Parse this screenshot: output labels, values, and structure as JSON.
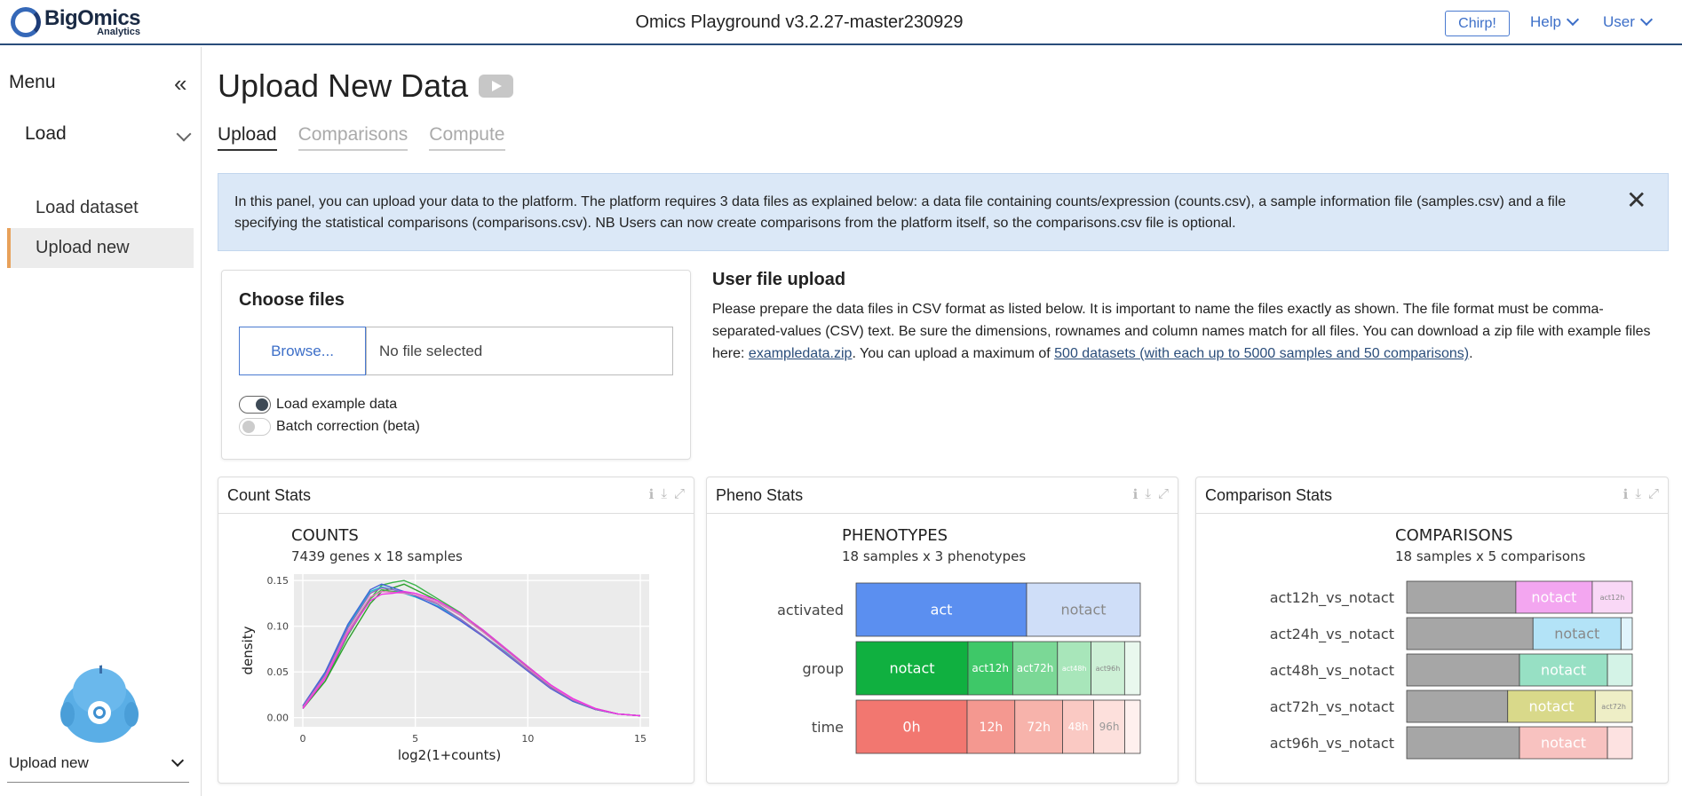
{
  "header": {
    "logo_main": "BigOmics",
    "logo_sub": "Analytics",
    "app_title": "Omics Playground v3.2.27-master230929",
    "chirp": "Chirp!",
    "help": "Help",
    "user": "User"
  },
  "sidebar": {
    "title": "Menu",
    "collapse_glyph": "«",
    "section": "Load",
    "items": [
      {
        "label": "Load dataset",
        "active": false
      },
      {
        "label": "Upload new",
        "active": true
      }
    ],
    "bottom_label": "Upload new"
  },
  "main": {
    "title": "Upload New Data",
    "tabs": [
      {
        "label": "Upload",
        "active": true
      },
      {
        "label": "Comparisons",
        "active": false
      },
      {
        "label": "Compute",
        "active": false
      }
    ],
    "info_text": "In this panel, you can upload your data to the platform. The platform requires 3 data files as explained below: a data file containing counts/expression (counts.csv), a sample information file (samples.csv) and a file specifying the statistical comparisons (comparisons.csv). NB Users can now create comparisons from the platform itself, so the comparisons.csv file is optional.",
    "info_close": "✕"
  },
  "choose_files": {
    "title": "Choose files",
    "browse_label": "Browse...",
    "file_status": "No file selected",
    "toggles": [
      {
        "label": "Load example data",
        "on": true
      },
      {
        "label": "Batch correction (beta)",
        "on": false
      }
    ]
  },
  "user_upload": {
    "title": "User file upload",
    "text_pre": "Please prepare the data files in CSV format as listed below. It is important to name the files exactly as shown. The file format must be comma-separated-values (CSV) text. Be sure the dimensions, rownames and column names match for all files. You can download a zip file with example files here: ",
    "link1": "exampledata.zip",
    "text_mid": ". You can upload a maximum of ",
    "link2": "500 datasets (with each up to 5000 samples and 50 comparisons)",
    "text_post": "."
  },
  "panels": {
    "count_stats": "Count Stats",
    "pheno_stats": "Pheno Stats",
    "comparison_stats": "Comparison Stats"
  },
  "chart_data": [
    {
      "type": "line",
      "title": "COUNTS",
      "subtitle": "7439 genes x 18 samples",
      "xlabel": "log2(1+counts)",
      "ylabel": "density",
      "xlim": [
        0,
        15
      ],
      "ylim": [
        0,
        0.15
      ],
      "xticks": [
        "0",
        "5",
        "10",
        "15"
      ],
      "yticks": [
        "0.00",
        "0.05",
        "0.10",
        "0.15"
      ],
      "x": [
        0,
        1,
        2,
        3,
        3.5,
        4,
        4.5,
        5,
        6,
        7,
        8,
        9,
        10,
        11,
        12,
        13,
        14,
        15
      ],
      "series": [
        {
          "color": "#3cb44b",
          "values": [
            0.01,
            0.04,
            0.09,
            0.13,
            0.145,
            0.148,
            0.15,
            0.145,
            0.13,
            0.115,
            0.095,
            0.075,
            0.055,
            0.035,
            0.02,
            0.01,
            0.004,
            0.002
          ]
        },
        {
          "color": "#2ca02c",
          "values": [
            0.01,
            0.04,
            0.085,
            0.125,
            0.138,
            0.142,
            0.146,
            0.14,
            0.128,
            0.114,
            0.096,
            0.076,
            0.056,
            0.036,
            0.02,
            0.01,
            0.004,
            0.002
          ]
        },
        {
          "color": "#4daf4a",
          "values": [
            0.012,
            0.045,
            0.092,
            0.13,
            0.14,
            0.138,
            0.137,
            0.134,
            0.126,
            0.112,
            0.094,
            0.075,
            0.054,
            0.034,
            0.019,
            0.009,
            0.004,
            0.002
          ]
        },
        {
          "color": "#17becf",
          "values": [
            0.012,
            0.048,
            0.1,
            0.138,
            0.143,
            0.14,
            0.136,
            0.132,
            0.122,
            0.108,
            0.09,
            0.072,
            0.052,
            0.033,
            0.018,
            0.009,
            0.004,
            0.002
          ]
        },
        {
          "color": "#4363d8",
          "values": [
            0.013,
            0.05,
            0.102,
            0.14,
            0.146,
            0.142,
            0.138,
            0.133,
            0.121,
            0.106,
            0.089,
            0.07,
            0.051,
            0.032,
            0.018,
            0.009,
            0.004,
            0.002
          ]
        },
        {
          "color": "#9467bd",
          "values": [
            0.012,
            0.047,
            0.098,
            0.136,
            0.142,
            0.14,
            0.137,
            0.134,
            0.124,
            0.108,
            0.09,
            0.071,
            0.052,
            0.033,
            0.019,
            0.009,
            0.004,
            0.002
          ]
        },
        {
          "color": "#e377c2",
          "values": [
            0.011,
            0.045,
            0.095,
            0.132,
            0.138,
            0.137,
            0.136,
            0.134,
            0.126,
            0.112,
            0.094,
            0.074,
            0.054,
            0.035,
            0.02,
            0.01,
            0.004,
            0.002
          ]
        },
        {
          "color": "#f032e6",
          "values": [
            0.01,
            0.043,
            0.092,
            0.128,
            0.135,
            0.136,
            0.138,
            0.136,
            0.128,
            0.114,
            0.096,
            0.076,
            0.056,
            0.036,
            0.021,
            0.01,
            0.004,
            0.002
          ]
        }
      ]
    },
    {
      "type": "bar",
      "title": "PHENOTYPES",
      "subtitle": "18 samples x 3 phenotypes",
      "rows": [
        {
          "name": "activated",
          "segments": [
            {
              "label": "act",
              "value": 15,
              "color": "#5b8ff0",
              "text_color": "#ffffff",
              "size": "large"
            },
            {
              "label": "notact",
              "value": 10,
              "color": "#cfdef8",
              "text_color": "#888888",
              "size": "large"
            }
          ]
        },
        {
          "name": "group",
          "segments": [
            {
              "label": "notact",
              "value": 10,
              "color": "#10b040",
              "text_color": "#ffffff",
              "size": "large"
            },
            {
              "label": "act12h",
              "value": 4,
              "color": "#3ec868",
              "text_color": "#ffffff",
              "size": "small"
            },
            {
              "label": "act72h",
              "value": 4,
              "color": "#7bd896",
              "text_color": "#ffffff",
              "size": "small"
            },
            {
              "label": "act48h",
              "value": 3,
              "color": "#a8e6ba",
              "text_color": "#ffffff",
              "size": "tiny"
            },
            {
              "label": "act96h",
              "value": 3,
              "color": "#cdf0d6",
              "text_color": "#888888",
              "size": "tiny"
            },
            {
              "label": "",
              "value": 1.4,
              "color": "#e9f8ee",
              "text_color": "#888888",
              "size": "tiny"
            }
          ]
        },
        {
          "name": "time",
          "segments": [
            {
              "label": "0h",
              "value": 10,
              "color": "#f27770",
              "text_color": "#ffffff",
              "size": "large"
            },
            {
              "label": "12h",
              "value": 4.3,
              "color": "#f49890",
              "text_color": "#ffffff",
              "size": "medium"
            },
            {
              "label": "72h",
              "value": 4.3,
              "color": "#f7b3ab",
              "text_color": "#ffffff",
              "size": "medium"
            },
            {
              "label": "48h",
              "value": 2.8,
              "color": "#fac9c3",
              "text_color": "#ffffff",
              "size": "small"
            },
            {
              "label": "96h",
              "value": 2.8,
              "color": "#fde0dc",
              "text_color": "#999999",
              "size": "small"
            },
            {
              "label": "",
              "value": 1.4,
              "color": "#fff0ee",
              "text_color": "#999999",
              "size": "tiny"
            }
          ]
        }
      ]
    },
    {
      "type": "bar",
      "title": "COMPARISONS",
      "subtitle": "18 samples x 5 comparisons",
      "rows": [
        {
          "name": "act12h_vs_notact",
          "segments": [
            {
              "label": "",
              "value": 9,
              "color": "#a6a6a6",
              "text_color": "#ffffff",
              "size": "large"
            },
            {
              "label": "notact",
              "value": 6.3,
              "color": "#f3a6f0",
              "text_color": "#ffffff",
              "size": "large"
            },
            {
              "label": "act12h",
              "value": 3.3,
              "color": "#f9d8f6",
              "text_color": "#888888",
              "size": "tiny"
            }
          ]
        },
        {
          "name": "act24h_vs_notact",
          "segments": [
            {
              "label": "",
              "value": 11.2,
              "color": "#a6a6a6",
              "text_color": "#ffffff",
              "size": "large"
            },
            {
              "label": "notact",
              "value": 7.8,
              "color": "#b3e3f7",
              "text_color": "#888888",
              "size": "large"
            },
            {
              "label": "",
              "value": 1,
              "color": "#e0f4fc",
              "text_color": "#888888",
              "size": "tiny"
            }
          ]
        },
        {
          "name": "act48h_vs_notact",
          "segments": [
            {
              "label": "",
              "value": 10,
              "color": "#a6a6a6",
              "text_color": "#ffffff",
              "size": "large"
            },
            {
              "label": "notact",
              "value": 7.8,
              "color": "#97e0c4",
              "text_color": "#ffffff",
              "size": "large"
            },
            {
              "label": "",
              "value": 2.2,
              "color": "#d4f3e7",
              "text_color": "#888888",
              "size": "tiny"
            }
          ]
        },
        {
          "name": "act72h_vs_notact",
          "segments": [
            {
              "label": "",
              "value": 9,
              "color": "#a6a6a6",
              "text_color": "#ffffff",
              "size": "large"
            },
            {
              "label": "notact",
              "value": 7.8,
              "color": "#d9d98a",
              "text_color": "#ffffff",
              "size": "large"
            },
            {
              "label": "act72h",
              "value": 3.3,
              "color": "#eeeec6",
              "text_color": "#888888",
              "size": "tiny"
            }
          ]
        },
        {
          "name": "act96h_vs_notact",
          "segments": [
            {
              "label": "",
              "value": 10,
              "color": "#a6a6a6",
              "text_color": "#ffffff",
              "size": "large"
            },
            {
              "label": "notact",
              "value": 7.8,
              "color": "#f8c2c0",
              "text_color": "#ffffff",
              "size": "large"
            },
            {
              "label": "",
              "value": 2.2,
              "color": "#fde2e1",
              "text_color": "#888888",
              "size": "tiny"
            }
          ]
        }
      ]
    }
  ]
}
